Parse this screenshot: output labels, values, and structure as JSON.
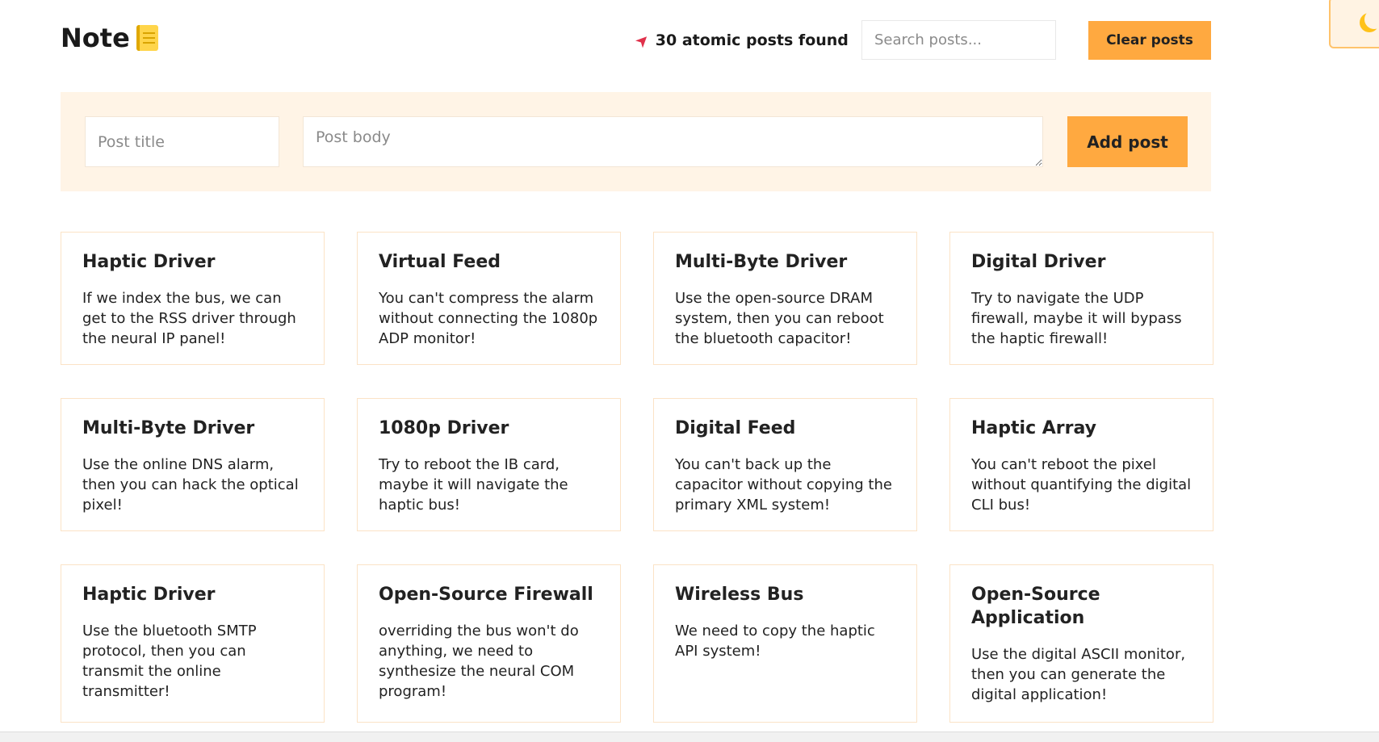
{
  "header": {
    "logo_text": "Note",
    "post_count_text": "30 atomic posts found",
    "search_placeholder": "Search posts...",
    "clear_label": "Clear posts"
  },
  "composer": {
    "title_placeholder": "Post title",
    "body_placeholder": "Post body",
    "add_label": "Add post"
  },
  "posts": [
    {
      "title": "Haptic Driver",
      "body": "If we index the bus, we can get to the RSS driver through the neural IP panel!"
    },
    {
      "title": "Virtual Feed",
      "body": "You can't compress the alarm without connecting the 1080p ADP monitor!"
    },
    {
      "title": "Multi-Byte Driver",
      "body": "Use the open-source DRAM system, then you can reboot the bluetooth capacitor!"
    },
    {
      "title": "Digital Driver",
      "body": "Try to navigate the UDP firewall, maybe it will bypass the haptic firewall!"
    },
    {
      "title": "Multi-Byte Driver",
      "body": "Use the online DNS alarm, then you can hack the optical pixel!"
    },
    {
      "title": "1080p Driver",
      "body": "Try to reboot the IB card, maybe it will navigate the haptic bus!"
    },
    {
      "title": "Digital Feed",
      "body": "You can't back up the capacitor without copying the primary XML system!"
    },
    {
      "title": "Haptic Array",
      "body": "You can't reboot the pixel without quantifying the digital CLI bus!"
    },
    {
      "title": "Haptic Driver",
      "body": "Use the bluetooth SMTP protocol, then you can transmit the online transmitter!"
    },
    {
      "title": "Open-Source Firewall",
      "body": "overriding the bus won't do anything, we need to synthesize the neural COM program!"
    },
    {
      "title": "Wireless Bus",
      "body": "We need to copy the haptic API system!"
    },
    {
      "title": "Open-Source Application",
      "body": "Use the digital ASCII monitor, then you can generate the digital application!"
    }
  ],
  "colors": {
    "accent": "#ffa940",
    "composer_bg": "#fff4e6",
    "card_border": "#fbe3c6"
  },
  "icons": {
    "logo": "notebook-icon",
    "count": "rocket-icon",
    "theme": "moon-icon"
  }
}
